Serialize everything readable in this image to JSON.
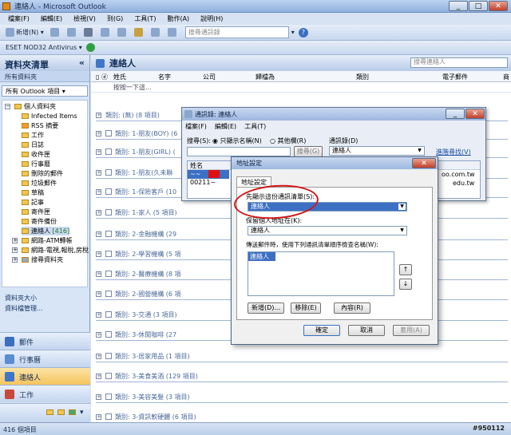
{
  "window": {
    "title": "連絡人 - Microsoft Outlook",
    "min": "_",
    "max": "□",
    "close": "✕"
  },
  "menu": [
    "檔案(F)",
    "編輯(E)",
    "檢視(V)",
    "到(G)",
    "工具(T)",
    "動作(A)",
    "說明(H)"
  ],
  "toolbar": {
    "new_label": "新增(N)",
    "search_placeholder": "搜尋通訊錄",
    "help": "?"
  },
  "toolbar2": {
    "addin_label": "ESET NOD32 Antivirus"
  },
  "nav": {
    "header": "資料夾清單",
    "collapse": "«",
    "subheader": "所有資料夾",
    "selector": "所有 Outlook 項目",
    "tree": [
      {
        "label": "個人資料夾",
        "indent": 0
      },
      {
        "label": "Infected Items",
        "indent": 1
      },
      {
        "label": "RSS 摘要",
        "indent": 1
      },
      {
        "label": "工作",
        "indent": 1
      },
      {
        "label": "日誌",
        "indent": 1
      },
      {
        "label": "收件匣",
        "indent": 1
      },
      {
        "label": "行事曆",
        "indent": 1
      },
      {
        "label": "刪除的郵件",
        "indent": 1
      },
      {
        "label": "垃圾郵件",
        "indent": 1
      },
      {
        "label": "草稿",
        "indent": 1
      },
      {
        "label": "記事",
        "indent": 1
      },
      {
        "label": "寄件匣",
        "indent": 1
      },
      {
        "label": "寄件備份",
        "indent": 1
      },
      {
        "label": "連絡人",
        "count": "[416]",
        "indent": 1
      },
      {
        "label": "網路-ATM轉帳",
        "indent": 1
      },
      {
        "label": "網路-電視,報稅,房稅",
        "indent": 1
      },
      {
        "label": "搜尋資料夾",
        "indent": 1
      }
    ],
    "links": [
      "資料夾大小",
      "資料檔管理..."
    ],
    "buttons": [
      "郵件",
      "行事曆",
      "連絡人",
      "工作"
    ]
  },
  "main": {
    "header": "連絡人",
    "search_placeholder": "搜尋連絡人",
    "columns": [
      "姓氏",
      "名字",
      "公司",
      "歸檔為",
      "類別",
      "電子郵件",
      "商"
    ],
    "new_row": "按按一下這...",
    "groups": [
      "類別: (無) (8 項目)",
      "類別: 1-朋友(BOY) (6",
      "類別: 1-朋友(GIRL) (",
      "類別: 1-朋友(久未聯",
      "類別: 1-保險客戶 (10",
      "類別: 1-家人 (5 項目)",
      "類別: 2-金融機構 (29",
      "類別: 2-學習機構 (5 項",
      "類別: 2-醫療機構 (8 項",
      "類別: 2-國營機構 (6 項",
      "類別: 3-交通 (3 項目)",
      "類別: 3-休閒咖啡 (27",
      "類別: 3-居家用品 (1 項目)",
      "類別: 3-美食美酒 (129 項目)",
      "類別: 3-美容美髮 (3 項目)",
      "類別: 3-資訊軟硬體 (6 項目)"
    ]
  },
  "addressbook": {
    "title": "通訊錄: 連絡人",
    "menu": [
      "檔案(F)",
      "編輯(E)",
      "工具(T)"
    ],
    "search_label": "搜尋(S):",
    "radio1": "只顯示名稱(N)",
    "radio2": "其他欄(R)",
    "book_label": "通訊錄(D)",
    "book_value": "連絡人",
    "go_button": "搜尋(G)",
    "advanced": "進階尋找(V)",
    "col_name": "姓名",
    "row1": "~~",
    "row2": "00211~",
    "email_tail1": "oo.com.tw",
    "email_tail2": "edu.tw"
  },
  "addrsettings": {
    "title": "地址設定",
    "tab": "地址設定",
    "label1": "先顯示這份通訊清單(S):",
    "value1": "連絡人",
    "label2": "保留個人地址在(K):",
    "value2": "連絡人",
    "label3": "傳送郵件時，使用下列通訊清單順序檢查名稱(W):",
    "list_item": "連絡人",
    "add": "新增(D)...",
    "remove": "移除(E)",
    "props": "內容(R)",
    "ok": "確定",
    "cancel": "取消",
    "apply": "套用(A)"
  },
  "status": {
    "items": "416 個項目",
    "watermark": "#950112"
  }
}
